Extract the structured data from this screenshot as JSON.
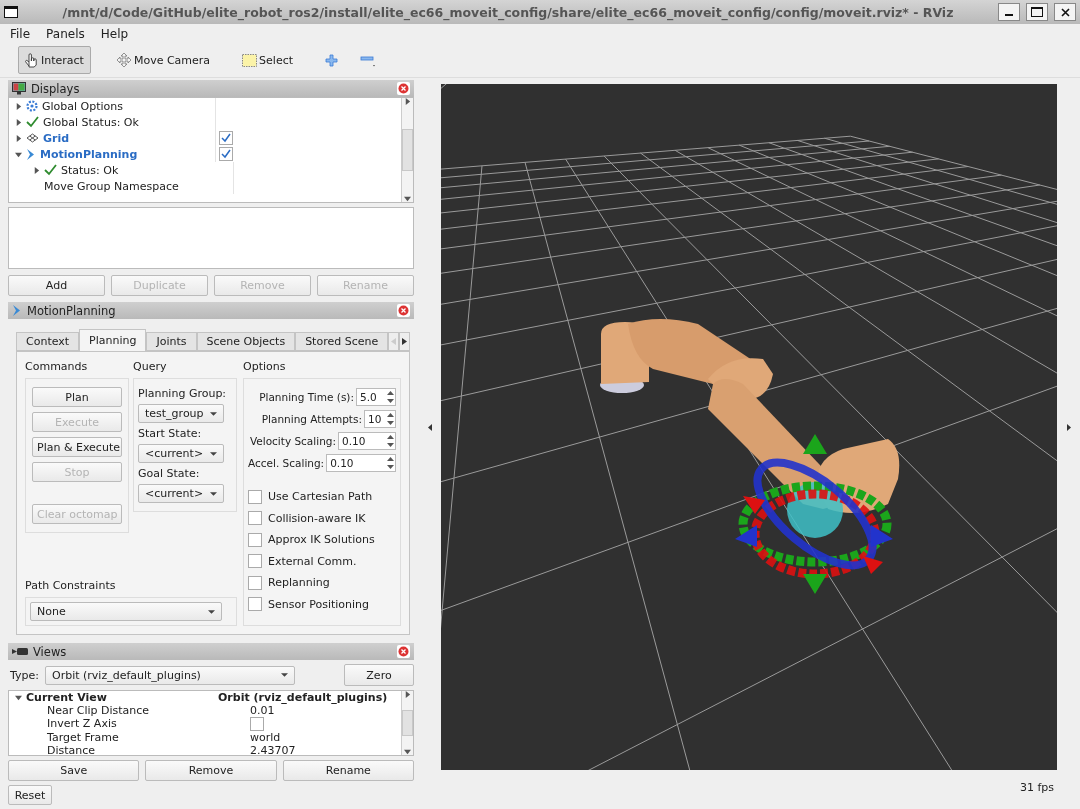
{
  "window": {
    "title": "/mnt/d/Code/GitHub/elite_robot_ros2/install/elite_ec66_moveit_config/share/elite_ec66_moveit_config/config/moveit.rviz* - RViz"
  },
  "menu": [
    "File",
    "Panels",
    "Help"
  ],
  "toolbar": [
    {
      "kind": "interact",
      "label": "Interact",
      "selected": true
    },
    {
      "kind": "move_camera",
      "label": "Move Camera",
      "selected": false
    },
    {
      "kind": "select",
      "label": "Select",
      "selected": false
    },
    {
      "kind": "plus",
      "selected": false
    },
    {
      "kind": "minus",
      "selected": false
    }
  ],
  "displays": {
    "title": "Displays",
    "tree": [
      {
        "kind": "gear",
        "label": "Global Options",
        "expanded": false
      },
      {
        "kind": "status",
        "label": "Global Status: Ok",
        "expanded": false
      },
      {
        "kind": "grid",
        "label": "Grid",
        "expanded": false,
        "checked": true
      },
      {
        "kind": "planning",
        "label": "MotionPlanning",
        "expanded": true,
        "checked": true,
        "children": [
          {
            "kind": "status",
            "label": "Status: Ok",
            "expanded": false
          },
          {
            "kind": "property",
            "label": "Move Group Namespace"
          }
        ]
      }
    ],
    "buttons": [
      {
        "label": "Add",
        "disabled": false
      },
      {
        "label": "Duplicate",
        "disabled": true
      },
      {
        "label": "Remove",
        "disabled": true
      },
      {
        "label": "Rename",
        "disabled": true
      }
    ]
  },
  "motion_planning": {
    "title": "MotionPlanning",
    "tabs": [
      {
        "label": "Context",
        "selected": false
      },
      {
        "label": "Planning",
        "selected": true
      },
      {
        "label": "Joints",
        "selected": false
      },
      {
        "label": "Scene Objects",
        "selected": false
      },
      {
        "label": "Stored Scene",
        "selected": false
      }
    ],
    "commands": {
      "title": "Commands",
      "buttons": [
        {
          "label": "Plan",
          "disabled": false
        },
        {
          "label": "Execute",
          "disabled": true
        },
        {
          "label": "Plan & Execute",
          "disabled": false
        },
        {
          "label": "Stop",
          "disabled": true
        },
        {
          "label": "Clear octomap",
          "disabled": true
        }
      ]
    },
    "query": {
      "title": "Query",
      "fields": [
        {
          "label": "Planning Group:",
          "value": "test_group"
        },
        {
          "label": "Start State:",
          "value": "<current>"
        },
        {
          "label": "Goal State:",
          "value": "<current>"
        }
      ]
    },
    "options": {
      "title": "Options",
      "spinners": [
        {
          "label": "Planning Time (s):",
          "value": "5.0"
        },
        {
          "label": "Planning Attempts:",
          "value": "10"
        },
        {
          "label": "Velocity Scaling:",
          "value": "0.10"
        },
        {
          "label": "Accel. Scaling:",
          "value": "0.10"
        }
      ],
      "checkboxes": [
        {
          "label": "Use Cartesian Path",
          "checked": false
        },
        {
          "label": "Collision-aware IK",
          "checked": false
        },
        {
          "label": "Approx IK Solutions",
          "checked": false
        },
        {
          "label": "External Comm.",
          "checked": false
        },
        {
          "label": "Replanning",
          "checked": false
        },
        {
          "label": "Sensor Positioning",
          "checked": false
        }
      ]
    },
    "path_constraints": {
      "label": "Path Constraints",
      "value": "None"
    }
  },
  "views": {
    "title": "Views",
    "type_label": "Type:",
    "type_value": "Orbit (rviz_default_plugins)",
    "zero": "Zero",
    "current": {
      "label": "Current View",
      "value": "Orbit (rviz_default_plugins)",
      "expanded": true
    },
    "rows": [
      {
        "kind": "text",
        "label": "Near Clip Distance",
        "value": "0.01"
      },
      {
        "kind": "checkbox",
        "label": "Invert Z Axis",
        "checked": false
      },
      {
        "kind": "text",
        "label": "Target Frame",
        "value": "world"
      },
      {
        "kind": "text",
        "label": "Distance",
        "value": "2.43707"
      }
    ],
    "buttons": [
      "Save",
      "Remove",
      "Rename"
    ],
    "reset": "Reset"
  },
  "status": {
    "fps": "31 fps"
  }
}
